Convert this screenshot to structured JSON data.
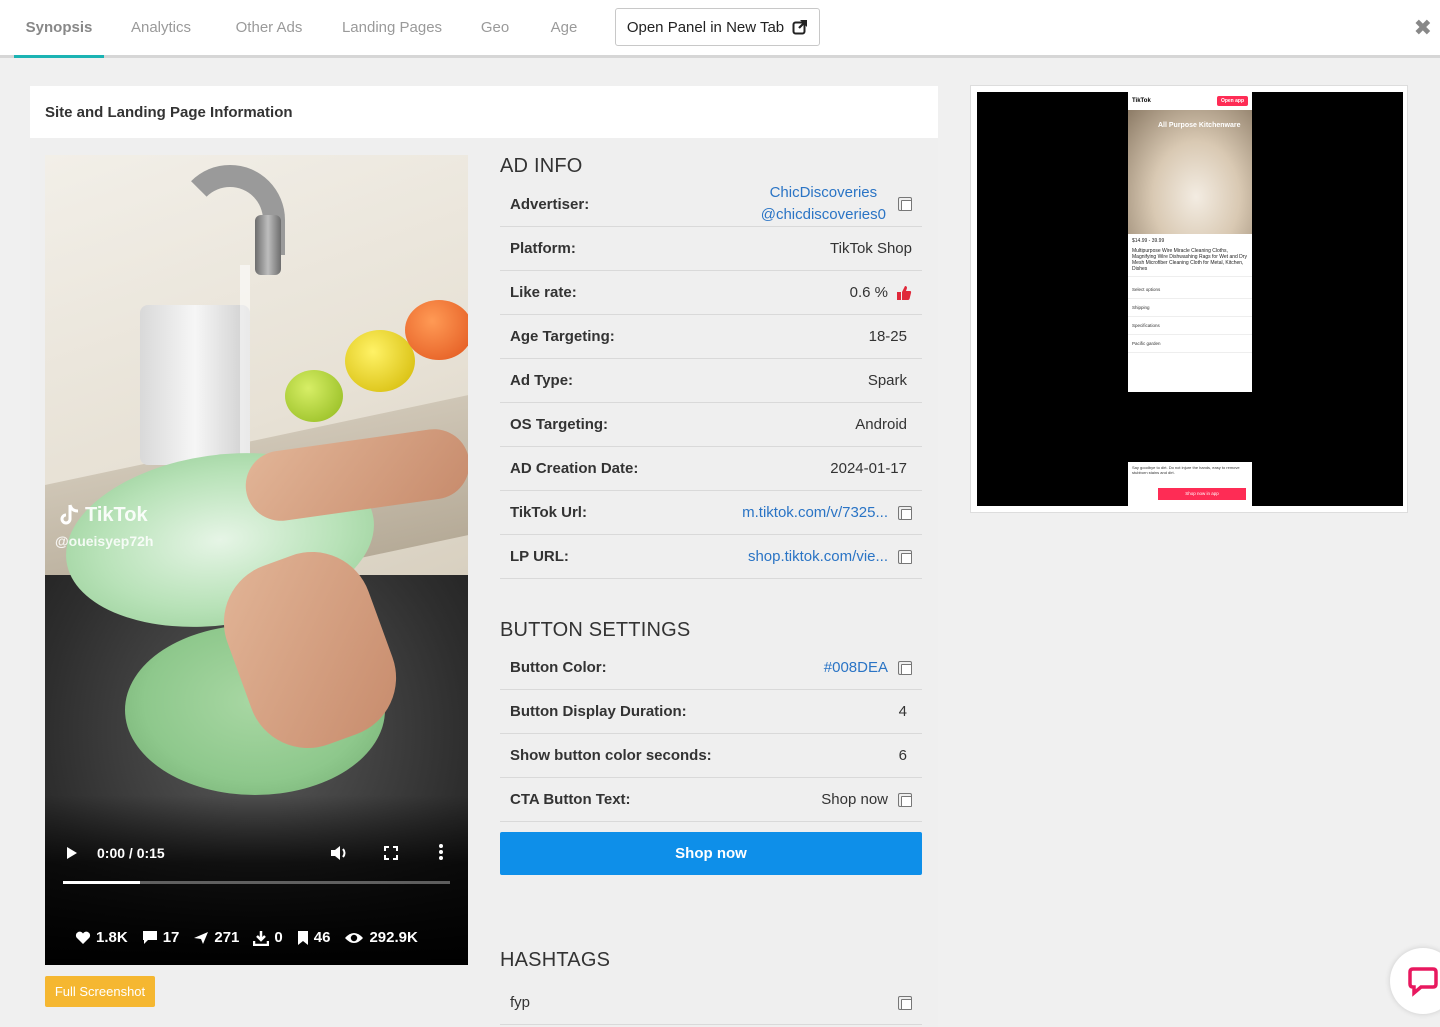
{
  "tabs": [
    {
      "label": "Synopsis",
      "active": true
    },
    {
      "label": "Analytics"
    },
    {
      "label": "Other Ads"
    },
    {
      "label": "Landing Pages"
    },
    {
      "label": "Geo"
    },
    {
      "label": "Age"
    }
  ],
  "open_panel_label": "Open Panel in New Tab",
  "close_icon": "close-icon",
  "panel_title": "Site and Landing Page Information",
  "video": {
    "brand": "TikTok",
    "handle": "@oueisyep72h",
    "time": "0:00 / 0:15",
    "progress": 0.2,
    "stats": {
      "likes": "1.8K",
      "comments": "17",
      "shares": "271",
      "downloads": "0",
      "saves": "46",
      "views": "292.9K"
    }
  },
  "full_screenshot_label": "Full Screenshot",
  "ad_info": {
    "title": "AD INFO",
    "advertiser_label": "Advertiser:",
    "advertiser_name": "ChicDiscoveries",
    "advertiser_handle": "@chicdiscoveries0",
    "rows": [
      {
        "label": "Platform:",
        "value": "TikTok Shop"
      },
      {
        "label": "Like rate:",
        "value": "0.6 %"
      },
      {
        "label": "Age Targeting:",
        "value": "18-25"
      },
      {
        "label": "Ad Type:",
        "value": "Spark"
      },
      {
        "label": "OS Targeting:",
        "value": "Android"
      },
      {
        "label": "AD Creation Date:",
        "value": "2024-01-17"
      },
      {
        "label": "TikTok Url:",
        "value": "m.tiktok.com/v/7325..."
      },
      {
        "label": "LP URL:",
        "value": "shop.tiktok.com/vie..."
      }
    ]
  },
  "button_settings": {
    "title": "BUTTON SETTINGS",
    "rows": [
      {
        "label": "Button Color:",
        "value": "#008DEA"
      },
      {
        "label": "Button Display Duration:",
        "value": "4"
      },
      {
        "label": "Show button color seconds:",
        "value": "6"
      },
      {
        "label": "CTA Button Text:",
        "value": "Shop now"
      }
    ],
    "button_label": "Shop now",
    "button_color": "#008DEA"
  },
  "hashtags": {
    "title": "HASHTAGS",
    "items": [
      "fyp"
    ]
  },
  "preview": {
    "app": "TikTok",
    "open_app": "Open app",
    "image_title": "All Purpose Kitchenware",
    "price": "$14.99 - 39.99",
    "description": "Multipurpose Wire Miracle Cleaning Cloths, Magnifying Wire Dishwashing Rags for Wet and Dry Mesh Microfiber Cleaning Cloth for Metal, Kitchen, Dishes",
    "rows": [
      "Select options",
      "Shipping",
      "Specifications",
      "Pacific garden"
    ],
    "bottom_text": "Say goodbye to dirt. Do not injure the hands, easy to remove stubborn stains and dirt.",
    "cta": "Shop now in app"
  },
  "colors": {
    "accent": "#1bb3b3",
    "link": "#2a74c5",
    "cta": "#0e8fe9",
    "screenshot_btn": "#f5b731",
    "like_thumb": "#e0283a"
  }
}
